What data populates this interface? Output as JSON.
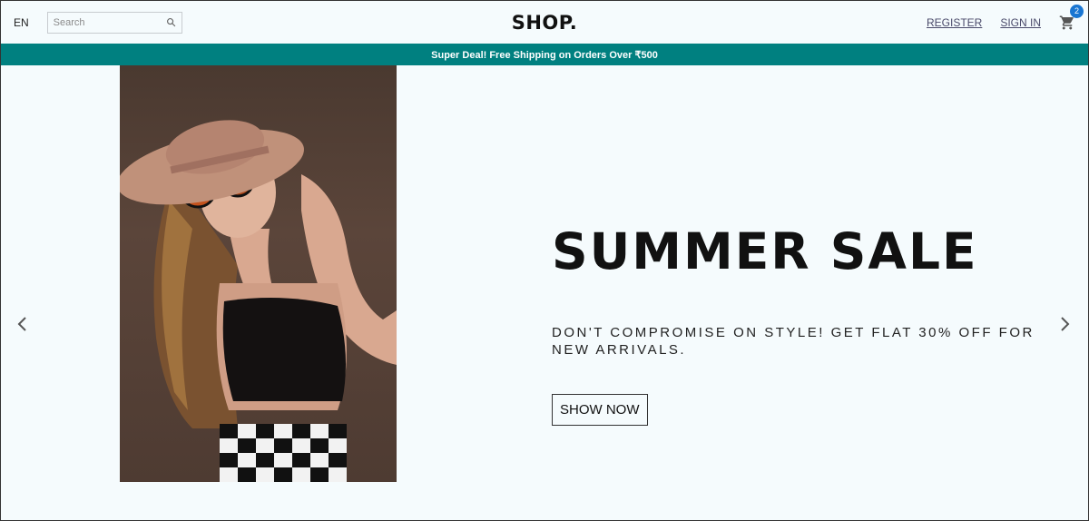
{
  "navbar": {
    "language": "EN",
    "search": {
      "placeholder": "Search",
      "value": ""
    },
    "logo": "SHOP.",
    "register_label": "REGISTER",
    "signin_label": "SIGN IN",
    "cart_count": "2"
  },
  "announcement": {
    "text": "Super Deal! Free Shipping on Orders Over ₹500"
  },
  "slide": {
    "title": "SUMMER SALE",
    "description": "DON'T COMPROMISE ON STYLE! GET FLAT 30% OFF FOR NEW ARRIVALS.",
    "button_label": "SHOW NOW"
  },
  "colors": {
    "background": "#f5fbfd",
    "announcement": "#008080",
    "badge": "#1976d2"
  }
}
